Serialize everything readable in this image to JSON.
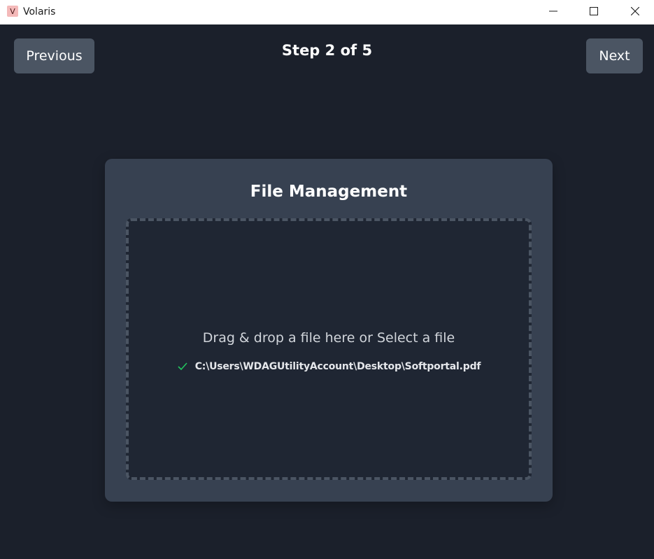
{
  "window": {
    "title": "Volaris",
    "icon_letter": "V"
  },
  "nav": {
    "previous_label": "Previous",
    "next_label": "Next",
    "step_text": "Step 2 of 5"
  },
  "card": {
    "title": "File Management",
    "dropzone": {
      "prompt": "Drag & drop a file here or Select a file",
      "selected_file": "C:\\Users\\WDAGUtilityAccount\\Desktop\\Softportal.pdf"
    }
  },
  "colors": {
    "background": "#1b202b",
    "card": "#374151",
    "button": "#4b5563",
    "check": "#22c55e"
  },
  "icons": {
    "minimize": "minimize-icon",
    "maximize": "maximize-icon",
    "close": "close-icon",
    "check": "check-icon"
  }
}
